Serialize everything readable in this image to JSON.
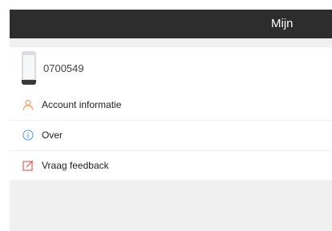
{
  "header": {
    "title": "Mijn"
  },
  "profile": {
    "number": "0700549",
    "device_icon": "phone-icon"
  },
  "menu": {
    "items": [
      {
        "label": "Account informatie",
        "icon": "user-icon",
        "icon_color": "#f0a060"
      },
      {
        "label": "Over",
        "icon": "info-icon",
        "icon_color": "#5aa0e6"
      },
      {
        "label": "Vraag feedback",
        "icon": "edit-icon",
        "icon_color": "#e8504a"
      }
    ]
  },
  "colors": {
    "navbar": "#2d2d2d",
    "background": "#f0f0f0"
  }
}
